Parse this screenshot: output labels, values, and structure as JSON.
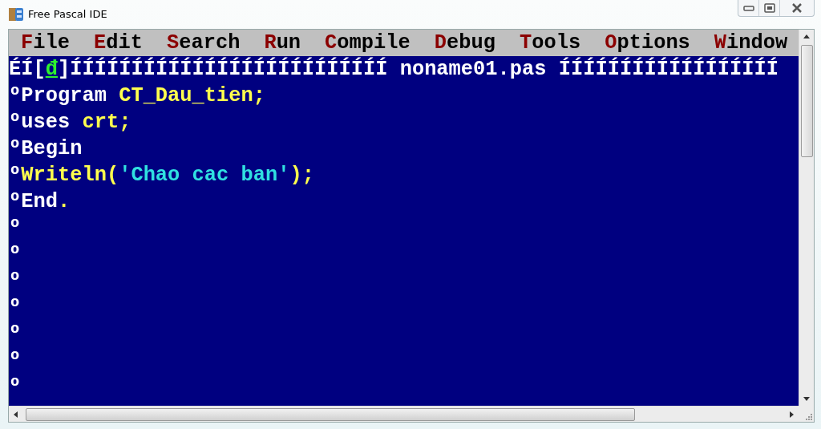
{
  "window": {
    "title": "Free Pascal IDE"
  },
  "menu": [
    {
      "label": "File"
    },
    {
      "label": "Edit"
    },
    {
      "label": "Search"
    },
    {
      "label": "Run"
    },
    {
      "label": "Compile"
    },
    {
      "label": "Debug"
    },
    {
      "label": "Tools"
    },
    {
      "label": "Options"
    },
    {
      "label": "Window"
    }
  ],
  "editor": {
    "frame_left": "ÉÍ",
    "close_box": "[đ]",
    "frame_mid": "ÍÍÍÍÍÍÍÍÍÍÍÍÍÍÍÍÍÍÍÍÍÍÍÍÍÍ",
    "file_name": "noname01.pas",
    "frame_right": "ÍÍÍÍÍÍÍÍÍÍÍÍÍÍÍÍÍÍ",
    "lines": [
      {
        "border": "º",
        "segments": [
          {
            "text": "Program ",
            "kind": "keyword"
          },
          {
            "text": "CT_Dau_tien;",
            "kind": "identifier"
          }
        ]
      },
      {
        "border": "º",
        "segments": [
          {
            "text": "uses ",
            "kind": "keyword"
          },
          {
            "text": "crt;",
            "kind": "identifier"
          }
        ]
      },
      {
        "border": "º",
        "segments": [
          {
            "text": "Begin",
            "kind": "keyword"
          }
        ]
      },
      {
        "border": "º",
        "segments": [
          {
            "text": "Writeln(",
            "kind": "identifier"
          },
          {
            "text": "'Chao cac ban'",
            "kind": "string"
          },
          {
            "text": ");",
            "kind": "identifier"
          }
        ]
      },
      {
        "border": "º",
        "segments": [
          {
            "text": "End",
            "kind": "keyword"
          },
          {
            "text": ".",
            "kind": "identifier"
          }
        ]
      },
      {
        "border": "º"
      },
      {
        "border": "º"
      },
      {
        "border": "º"
      },
      {
        "border": "º"
      },
      {
        "border": "º"
      },
      {
        "border": "º"
      },
      {
        "border": "º"
      }
    ]
  }
}
